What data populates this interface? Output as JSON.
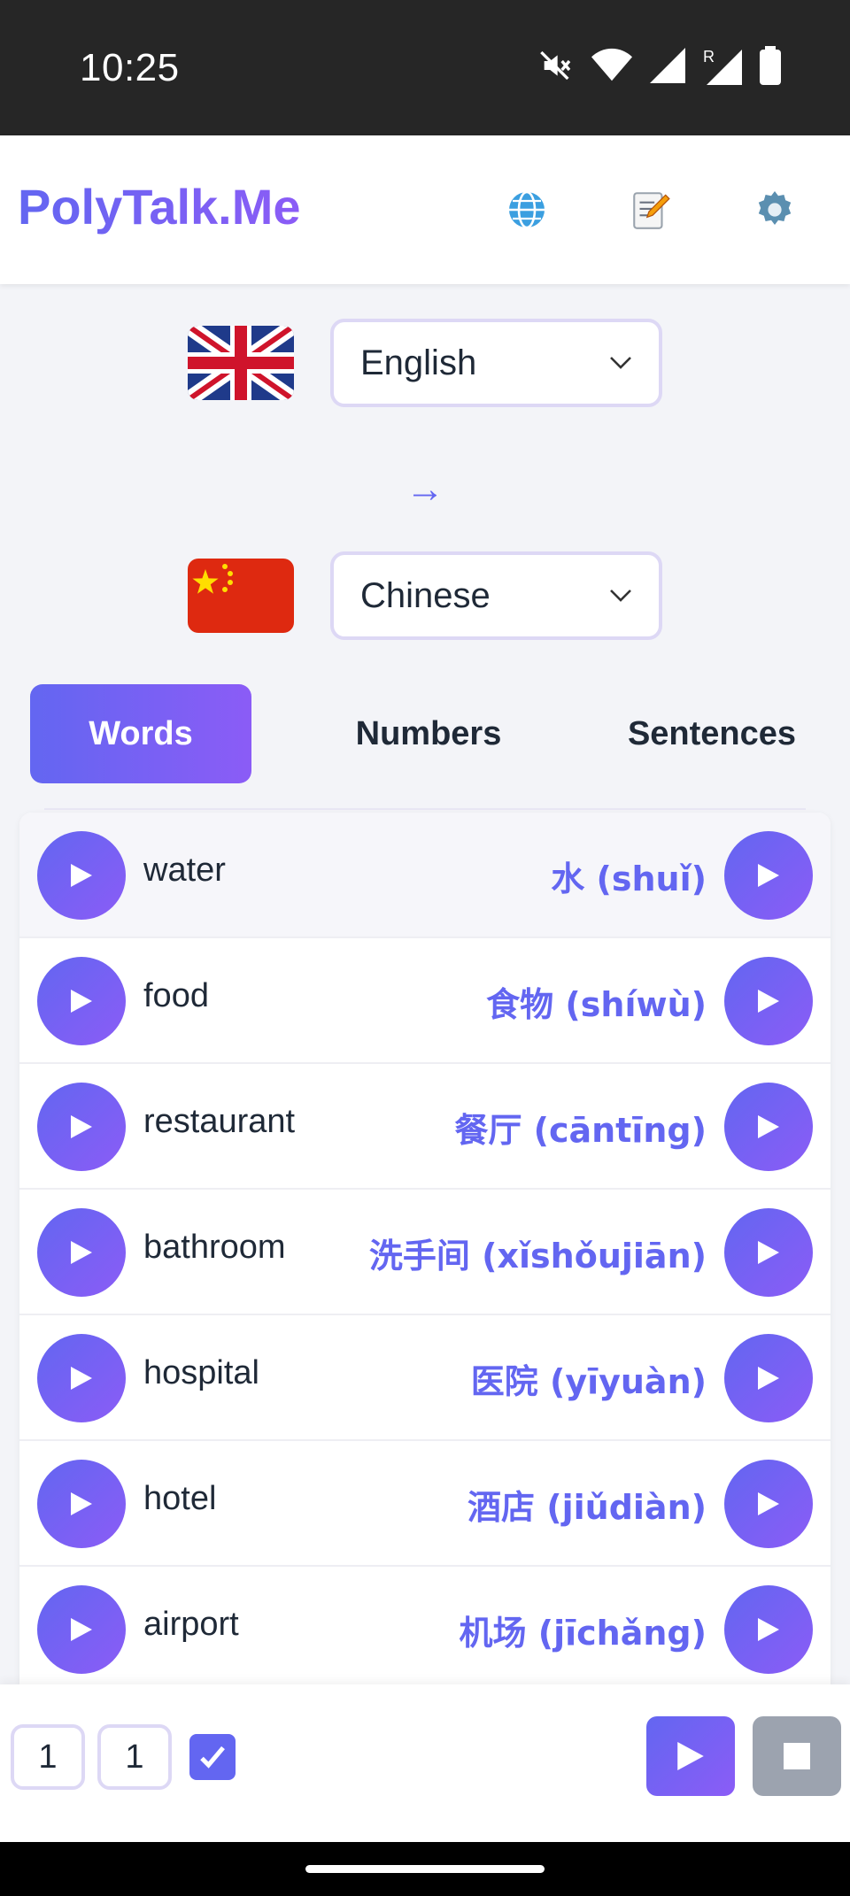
{
  "status_bar": {
    "time": "10:25",
    "icons": [
      "mute-icon",
      "wifi-icon",
      "signal-icon",
      "signal-roaming-icon",
      "battery-icon"
    ]
  },
  "header": {
    "brand": "PolyTalk.Me",
    "actions": [
      {
        "name": "globe-icon",
        "glyph": "🌐"
      },
      {
        "name": "memo-icon",
        "glyph": "📝"
      },
      {
        "name": "gear-icon",
        "glyph": "⚙"
      }
    ]
  },
  "languages": {
    "source": {
      "label": "English",
      "flag": "uk-flag"
    },
    "arrow": "→",
    "target": {
      "label": "Chinese",
      "flag": "china-flag"
    }
  },
  "tabs": [
    {
      "label": "Words",
      "active": true
    },
    {
      "label": "Numbers",
      "active": false
    },
    {
      "label": "Sentences",
      "active": false
    }
  ],
  "words": [
    {
      "en": "water",
      "zh": "水 (shuǐ)"
    },
    {
      "en": "food",
      "zh": "食物 (shíwù)"
    },
    {
      "en": "restaurant",
      "zh": "餐厅 (cāntīng)"
    },
    {
      "en": "bathroom",
      "zh": "洗手间 (xǐshǒujiān)"
    },
    {
      "en": "hospital",
      "zh": "医院 (yīyuàn)"
    },
    {
      "en": "hotel",
      "zh": "酒店 (jiǔdiàn)"
    },
    {
      "en": "airport",
      "zh": "机场 (jīchǎng)"
    }
  ],
  "controls": {
    "repeat_value": "1",
    "pause_value": "1",
    "checkbox_checked": true
  },
  "colors": {
    "accent": "#6366f1",
    "accent_end": "#8b5cf6",
    "stop_button": "#9ca3af"
  }
}
